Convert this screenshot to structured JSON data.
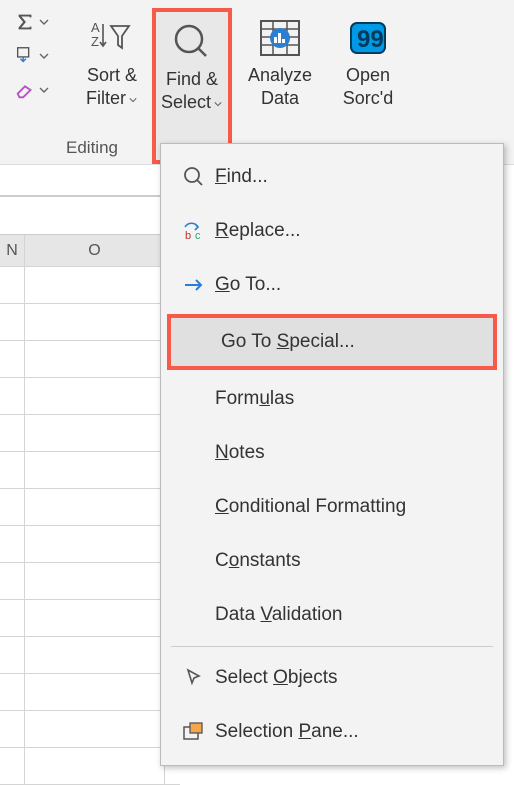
{
  "ribbon": {
    "sort_filter": "Sort &\nFilter",
    "find_select": "Find &\nSelect",
    "analyze_data": "Analyze\nData",
    "open_sorcd": "Open\nSorc'd",
    "group_editing": "Editing"
  },
  "columns": {
    "n": "N",
    "o": "O"
  },
  "menu": {
    "find": "Find...",
    "replace": "Replace...",
    "goto": "Go To...",
    "goto_special": "Go To Special...",
    "formulas": "Formulas",
    "notes": "Notes",
    "cond_fmt": "Conditional Formatting",
    "constants": "Constants",
    "data_val": "Data Validation",
    "sel_obj": "Select Objects",
    "sel_pane": "Selection Pane..."
  }
}
